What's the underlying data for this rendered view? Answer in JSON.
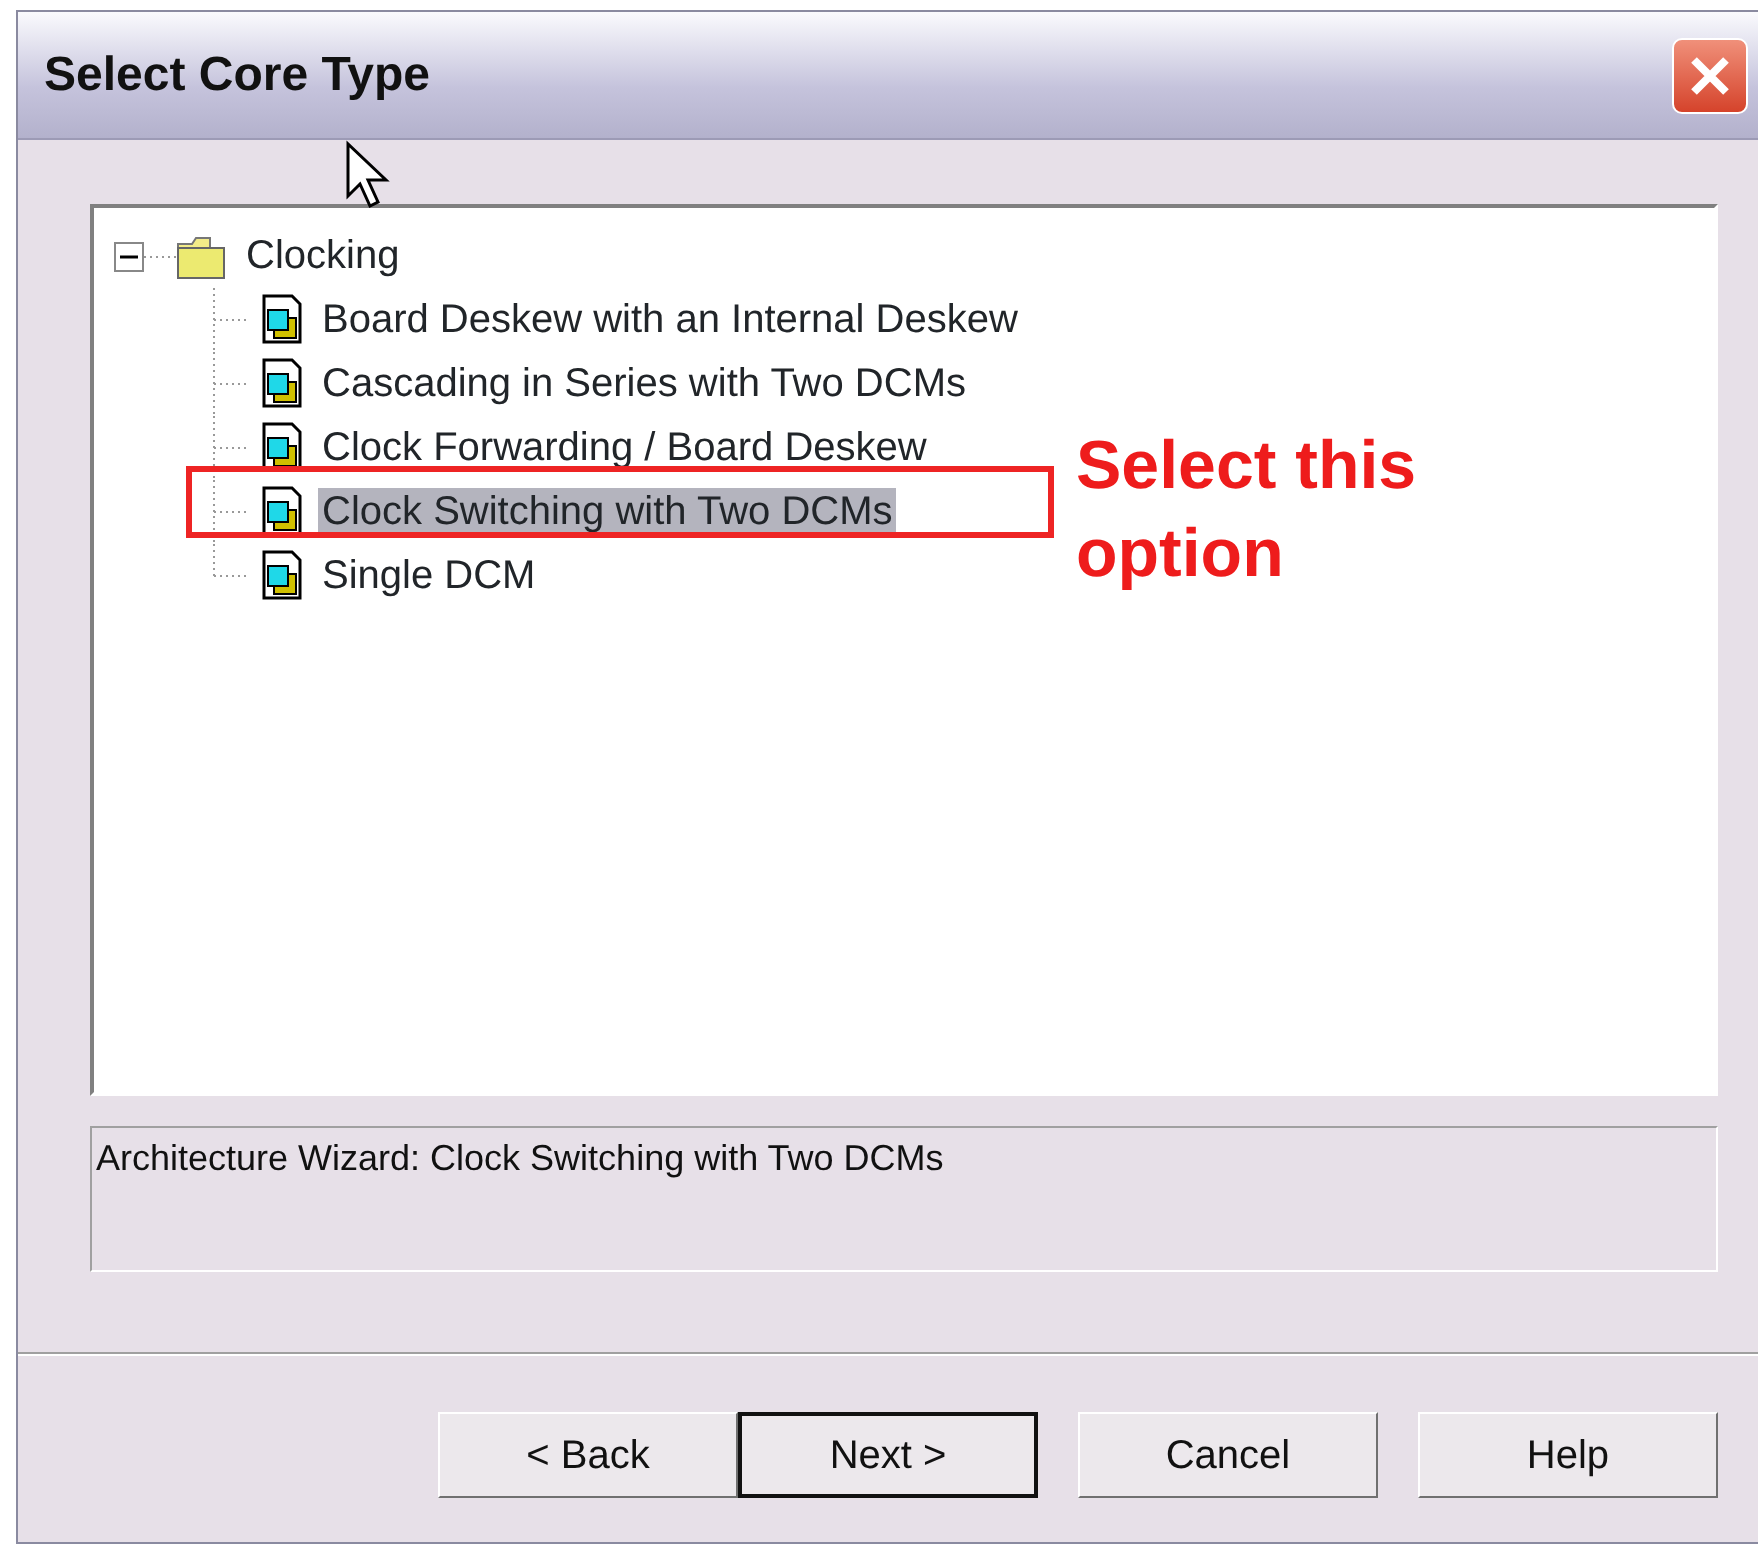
{
  "window": {
    "title": "Select Core Type"
  },
  "tree": {
    "items": [
      {
        "label": "Clocking",
        "expanded": true,
        "selected": false,
        "children": [
          {
            "label": "Board Deskew with an Internal Deskew",
            "selected": false
          },
          {
            "label": "Cascading in Series with Two DCMs",
            "selected": false
          },
          {
            "label": "Clock Forwarding / Board Deskew",
            "selected": false
          },
          {
            "label": "Clock Switching with Two DCMs",
            "selected": true
          },
          {
            "label": "Single DCM",
            "selected": false
          }
        ]
      }
    ]
  },
  "description": "Architecture Wizard: Clock Switching with Two DCMs",
  "buttons": [
    {
      "label": "< Back",
      "default": false
    },
    {
      "label": "Next >",
      "default": true
    },
    {
      "label": "Cancel",
      "default": false
    },
    {
      "label": "Help",
      "default": false
    }
  ],
  "annotation": {
    "text": "Select this option"
  }
}
